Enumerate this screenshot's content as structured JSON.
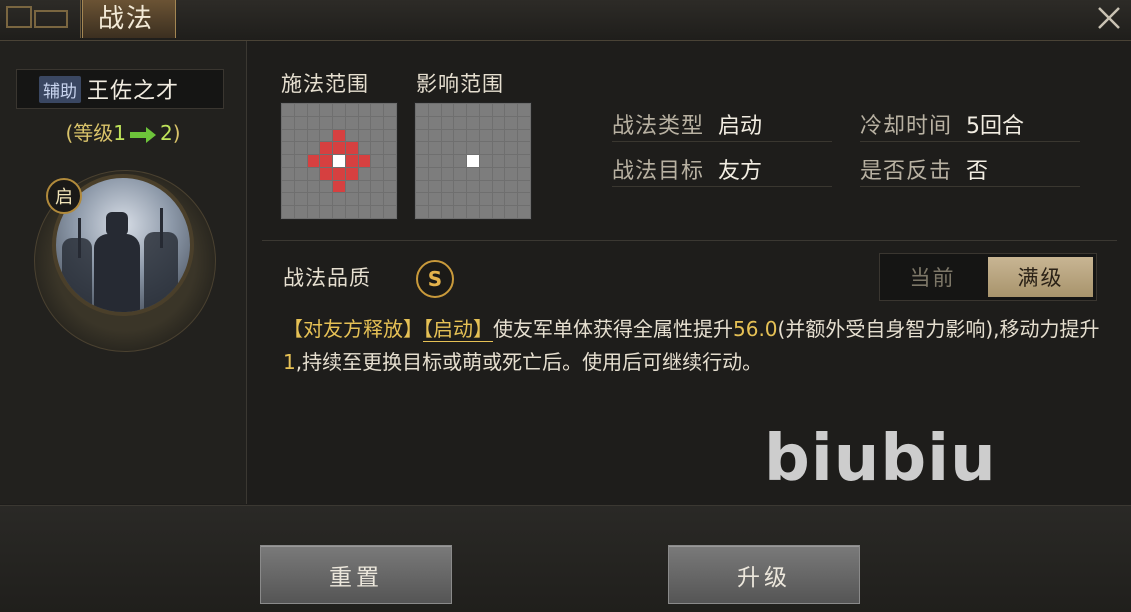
{
  "window": {
    "title": "战法",
    "close_icon": "close-icon"
  },
  "skill": {
    "role_tag": "辅助",
    "name": "王佐之才",
    "level_prefix": "(等级",
    "level_from": "1",
    "level_to": "2",
    "level_suffix": ")",
    "badge": "启"
  },
  "ranges": {
    "cast_label": "施法范围",
    "effect_label": "影响范围"
  },
  "info": {
    "type_key": "战法类型",
    "type_val": "启动",
    "cooldown_key": "冷却时间",
    "cooldown_val": "5回合",
    "target_key": "战法目标",
    "target_val": "友方",
    "counter_key": "是否反击",
    "counter_val": "否"
  },
  "quality": {
    "label": "战法品质",
    "grade": "S"
  },
  "toggle": {
    "current": "当前",
    "max": "满级",
    "selected": "满级"
  },
  "description": {
    "tag1": "【对友方释放】",
    "tag2": "【启动】",
    "part1": "使友军单体获得全属性提升",
    "value1": "56.0",
    "part2": "(并额外受自身智力影响),移动力提升",
    "value2": "1",
    "part3": ",持续至更换目标或萌或死亡后。使用后可继续行动。"
  },
  "watermark": "biubiu",
  "buttons": {
    "reset": "重置",
    "upgrade": "升级"
  },
  "colors": {
    "accent_gold": "#e6c155",
    "grid_red": "#d64040",
    "toggle_active": "#c8b593"
  }
}
